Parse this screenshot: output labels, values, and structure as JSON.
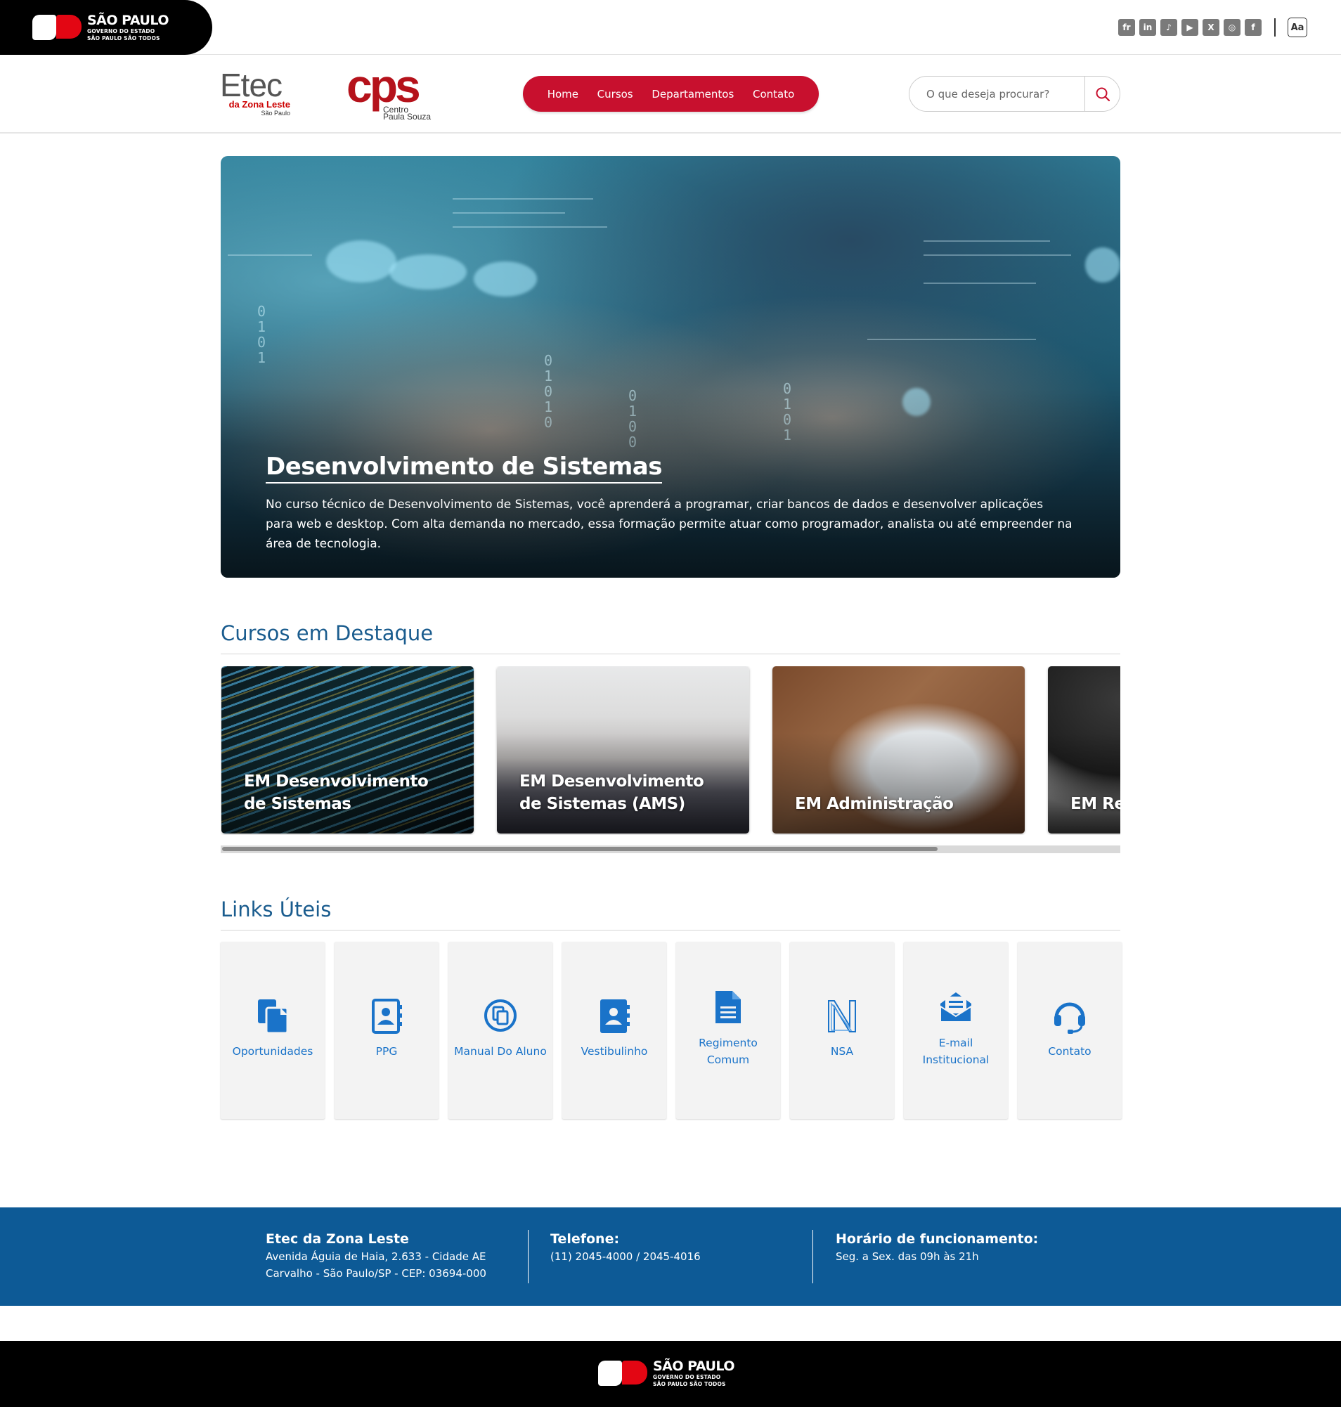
{
  "gov_bar": {
    "logo": {
      "title": "SÃO PAULO",
      "line2": "GOVERNO DO ESTADO",
      "line3": "SÃO PAULO SÃO TODOS"
    },
    "social": [
      {
        "name": "flickr-icon",
        "glyph": "fr"
      },
      {
        "name": "linkedin-icon",
        "glyph": "in"
      },
      {
        "name": "tiktok-icon",
        "glyph": "♪"
      },
      {
        "name": "youtube-icon",
        "glyph": "▶"
      },
      {
        "name": "x-icon",
        "glyph": "X"
      },
      {
        "name": "instagram-icon",
        "glyph": "◎"
      },
      {
        "name": "facebook-icon",
        "glyph": "f"
      }
    ],
    "font_toggle": "Aa"
  },
  "header": {
    "etec_logo": {
      "title": "Etec",
      "line2": "da Zona Leste",
      "line3": "São Paulo"
    },
    "cps_logo": {
      "title": "cps",
      "line2": "Centro",
      "line3": "Paula Souza"
    },
    "nav": [
      "Home",
      "Cursos",
      "Departamentos",
      "Contato"
    ],
    "search_placeholder": "O que deseja procurar?"
  },
  "hero": {
    "title": "Desenvolvimento de Sistemas",
    "text": "No curso técnico de Desenvolvimento de Sistemas, você aprenderá a programar, criar bancos de dados e desenvolver aplicações para web e desktop. Com alta demanda no mercado, essa formação permite atuar como programador, analista ou até empreender na área de tecnologia."
  },
  "featured": {
    "title": "Cursos em Destaque",
    "cards": [
      {
        "label": "EM Desenvolvimento de Sistemas"
      },
      {
        "label": "EM Desenvolvimento de Sistemas (AMS)"
      },
      {
        "label": "EM Administração"
      },
      {
        "label": "EM Rec"
      }
    ]
  },
  "links": {
    "title": "Links Úteis",
    "items": [
      {
        "label": "Oportunidades",
        "icon": "clipboard-icon"
      },
      {
        "label": "PPG",
        "icon": "contact-book-icon"
      },
      {
        "label": "Manual Do Aluno",
        "icon": "copy-circle-icon"
      },
      {
        "label": "Vestibulinho",
        "icon": "address-book-icon"
      },
      {
        "label": "Regimento Comum",
        "icon": "document-icon"
      },
      {
        "label": "NSA",
        "icon": "nsa-logo-icon"
      },
      {
        "label": "E-mail Institucional",
        "icon": "email-icon"
      },
      {
        "label": "Contato",
        "icon": "headset-icon"
      }
    ]
  },
  "footer": {
    "col1": {
      "title": "Etec da Zona Leste",
      "line1": "Avenida Águia de Haia, 2.633 - Cidade AE",
      "line2": "Carvalho - São Paulo/SP - CEP: 03694-000"
    },
    "col2": {
      "title": "Telefone:",
      "line1": "(11) 2045-4000 / 2045-4016"
    },
    "col3": {
      "title": "Horário de funcionamento:",
      "line1": "Seg. a Sex. das 09h às 21h"
    }
  },
  "colors": {
    "brand_red": "#c8102e",
    "brand_blue": "#0d5a96",
    "title_blue": "#1a5c8e",
    "link_blue": "#1a73c9"
  }
}
